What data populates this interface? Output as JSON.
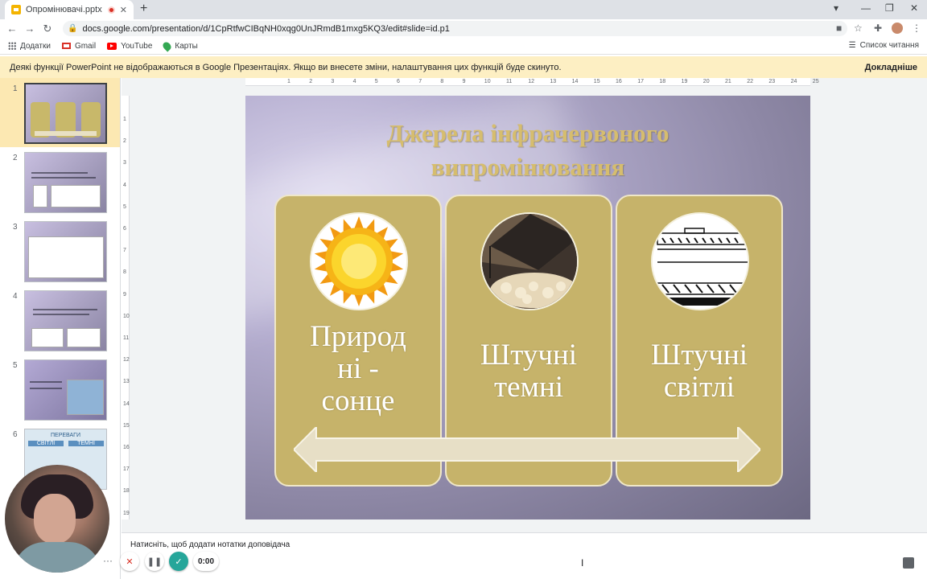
{
  "browser": {
    "tab_title": "Опромінювачі.pptx - Googl",
    "url": "docs.google.com/presentation/d/1CpRtfwCIBqNH0xqg0UnJRmdB1mxg5KQ3/edit#slide=id.p1",
    "bookmarks": [
      "Додатки",
      "Gmail",
      "YouTube",
      "Карты"
    ],
    "reading_list": "Список читання"
  },
  "banner": {
    "message": "Деякі функції PowerPoint не відображаються в Google Презентаціях. Якщо ви внесете зміни, налаштування цих функцій буде скинуто.",
    "link": "Докладніше"
  },
  "filmstrip": {
    "slides": [
      {
        "num": "1",
        "selected": true
      },
      {
        "num": "2"
      },
      {
        "num": "3"
      },
      {
        "num": "4"
      },
      {
        "num": "5"
      },
      {
        "num": "6"
      }
    ],
    "thumb6_heading": "ПЕРЕВАГИ",
    "thumb6_left": "СВІТЛІ",
    "thumb6_right": "ТЕМНІ"
  },
  "ruler": {
    "h_ticks": [
      "1",
      "2",
      "3",
      "4",
      "5",
      "6",
      "7",
      "8",
      "9",
      "10",
      "11",
      "12",
      "13",
      "14",
      "15",
      "16",
      "17",
      "18",
      "19",
      "20",
      "21",
      "22",
      "23",
      "24",
      "25"
    ],
    "v_ticks": [
      "1",
      "2",
      "3",
      "4",
      "5",
      "6",
      "7",
      "8",
      "9",
      "10",
      "11",
      "12",
      "13",
      "14",
      "15",
      "16",
      "17",
      "18",
      "19"
    ]
  },
  "slide": {
    "title_line1": "Джерела інфрачервоного",
    "title_line2": "випромінювання",
    "cards": [
      {
        "line1": "Природ",
        "line2": "ні -",
        "line3": "сонце",
        "icon": "sun-icon"
      },
      {
        "line1": "Штучні",
        "line2": "темні",
        "icon": "dark-heater-photo"
      },
      {
        "line1": "Штучні",
        "line2": "світлі",
        "icon": "light-heater-drawing"
      }
    ]
  },
  "notes": {
    "placeholder": "Натисніть, щоб додати нотатки доповідача"
  },
  "recorder": {
    "time": "0:00"
  },
  "colors": {
    "card": "#c6b36a",
    "title": "#d6bd6e",
    "banner": "#fdefc3"
  }
}
